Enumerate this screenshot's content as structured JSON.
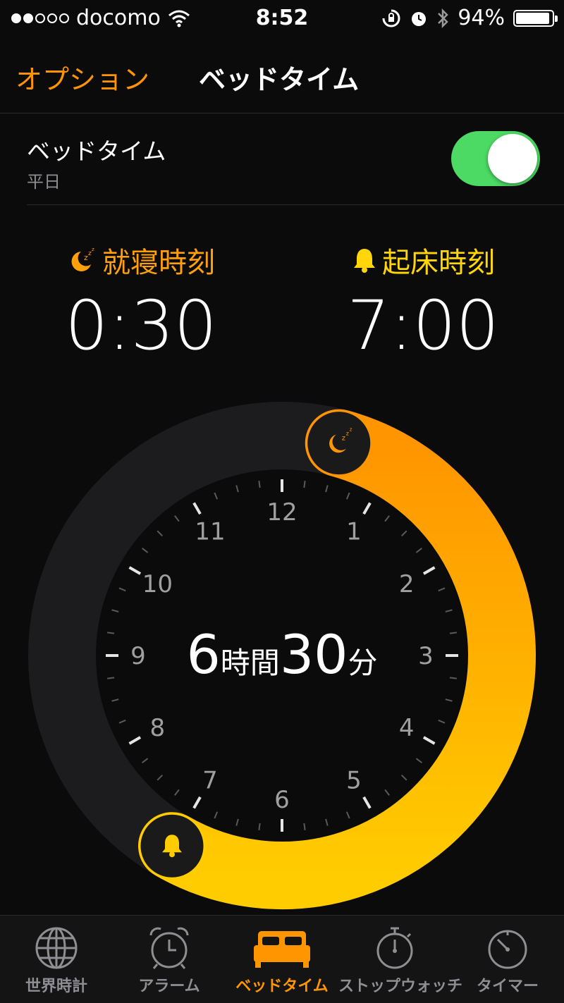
{
  "status_bar": {
    "carrier": "docomo",
    "time": "8:52",
    "battery": "94%",
    "battery_level": 0.94
  },
  "nav": {
    "back": "オプション",
    "title": "ベッドタイム"
  },
  "bedtime_row": {
    "label": "ベッドタイム",
    "sub": "平日",
    "enabled": true
  },
  "bedtime": {
    "label": "就寝時刻",
    "time": "0:30"
  },
  "wake": {
    "label": "起床時刻",
    "time": "7:00"
  },
  "clock": {
    "hours": [
      "12",
      "1",
      "2",
      "3",
      "4",
      "5",
      "6",
      "7",
      "8",
      "9",
      "10",
      "11"
    ],
    "duration_hours": "6",
    "duration_hours_unit": "時間",
    "duration_minutes": "30",
    "duration_minutes_unit": "分",
    "colors": {
      "start": "#ff9500",
      "end": "#ffcc00",
      "track": "#1c1c1e"
    }
  },
  "tabs": [
    {
      "label": "世界時計",
      "icon": "globe-icon",
      "active": false
    },
    {
      "label": "アラーム",
      "icon": "alarm-clock-icon",
      "active": false
    },
    {
      "label": "ベッドタイム",
      "icon": "bed-icon",
      "active": true
    },
    {
      "label": "ストップウォッチ",
      "icon": "stopwatch-icon",
      "active": false
    },
    {
      "label": "タイマー",
      "icon": "timer-icon",
      "active": false
    }
  ],
  "accent_color": "#ff9500"
}
